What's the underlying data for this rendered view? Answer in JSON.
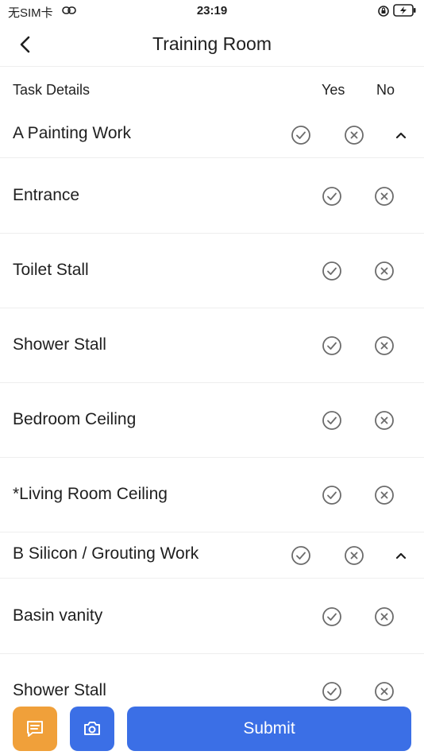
{
  "status_bar": {
    "carrier": "无SIM卡",
    "time": "23:19"
  },
  "nav": {
    "title": "Training Room"
  },
  "table_header": {
    "task": "Task Details",
    "yes": "Yes",
    "no": "No"
  },
  "sections": [
    {
      "label": "A Painting Work",
      "items": [
        "Entrance",
        "Toilet Stall",
        "Shower Stall",
        "Bedroom Ceiling",
        "*Living Room Ceiling"
      ]
    },
    {
      "label": "B Silicon / Grouting Work",
      "items": [
        "Basin vanity",
        "Shower Stall"
      ]
    }
  ],
  "bottom_bar": {
    "submit_label": "Submit"
  },
  "colors": {
    "accent": "#3b6fe6",
    "comment_button": "#f0a03a",
    "icon_gray": "#6b6b6b"
  }
}
